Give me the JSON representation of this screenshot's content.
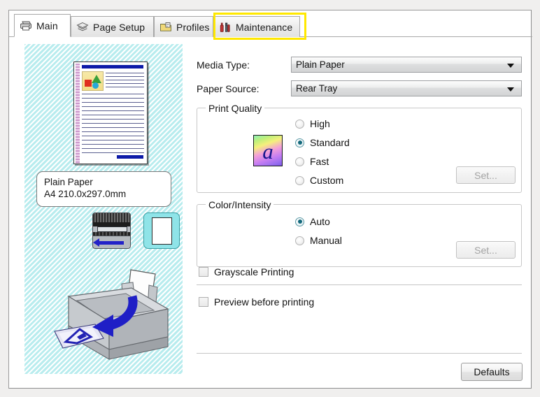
{
  "tabs": [
    {
      "id": "main",
      "label": "Main",
      "icon": "printer-icon",
      "active": true,
      "highlighted": false
    },
    {
      "id": "page-setup",
      "label": "Page Setup",
      "icon": "layers-icon",
      "active": false,
      "highlighted": false
    },
    {
      "id": "profiles",
      "label": "Profiles",
      "icon": "folder-icon",
      "active": false,
      "highlighted": false
    },
    {
      "id": "maintenance",
      "label": "Maintenance",
      "icon": "tools-icon",
      "active": false,
      "highlighted": true
    }
  ],
  "preview": {
    "info_line1": "Plain Paper",
    "info_line2": "A4 210.0x297.0mm",
    "printer_icon_name": "printer-feed-icon",
    "paper_icon_name": "paper-sheet-icon",
    "illustration_name": "printer-paper-path-illustration"
  },
  "fields": {
    "media_type": {
      "label": "Media Type:",
      "value": "Plain Paper"
    },
    "paper_source": {
      "label": "Paper Source:",
      "value": "Rear Tray"
    }
  },
  "print_quality": {
    "title": "Print Quality",
    "icon": "quality-sample-icon",
    "options": [
      {
        "label": "High",
        "selected": false
      },
      {
        "label": "Standard",
        "selected": true
      },
      {
        "label": "Fast",
        "selected": false
      },
      {
        "label": "Custom",
        "selected": false
      }
    ],
    "set_button": {
      "label": "Set...",
      "disabled": true
    }
  },
  "color_intensity": {
    "title": "Color/Intensity",
    "options": [
      {
        "label": "Auto",
        "selected": true
      },
      {
        "label": "Manual",
        "selected": false
      }
    ],
    "set_button": {
      "label": "Set...",
      "disabled": true
    }
  },
  "checkboxes": [
    {
      "label": "Grayscale Printing",
      "checked": false
    },
    {
      "label": "Preview before printing",
      "checked": false
    }
  ],
  "footer": {
    "defaults_button": "Defaults"
  },
  "colors": {
    "accent_radio": "#14697c",
    "highlight": "#ffe800",
    "preview_bg": "#b8ecee",
    "doc_bar": "#0d1aa8",
    "arrow_blue": "#2222c8"
  }
}
